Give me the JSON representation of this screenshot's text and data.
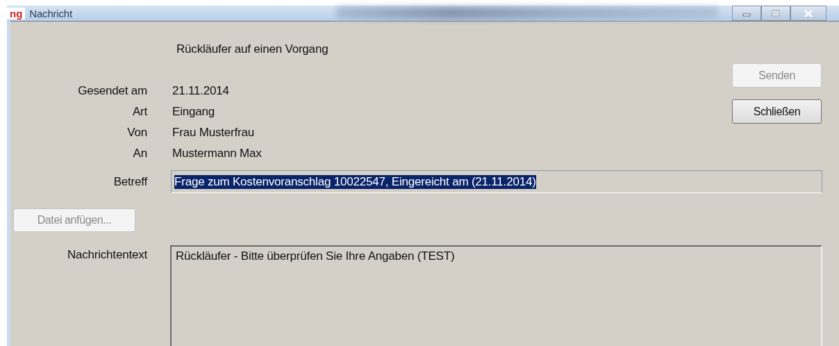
{
  "window": {
    "logo": "ng",
    "title": "Nachricht"
  },
  "heading": "Rückläufer auf einen Vorgang",
  "fields": [
    {
      "label": "Gesendet am",
      "value": "21.11.2014"
    },
    {
      "label": "Art",
      "value": "Eingang"
    },
    {
      "label": "Von",
      "value": "Frau Musterfrau"
    },
    {
      "label": "An",
      "value": "Mustermann Max"
    }
  ],
  "subject": {
    "label": "Betreff",
    "value": "Frage zum Kostenvoranschlag 10022547, Eingereicht am (21.11.2014)",
    "selected": true
  },
  "buttons": [
    {
      "label": "Senden",
      "disabled": true
    },
    {
      "label": "Schließen",
      "disabled": false
    }
  ],
  "attach_button": {
    "label": "Datei anfügen...",
    "disabled": true
  },
  "message": {
    "label": "Nachrichtentext",
    "value": "Rückläufer - Bitte überprüfen Sie Ihre Angaben (TEST)"
  }
}
